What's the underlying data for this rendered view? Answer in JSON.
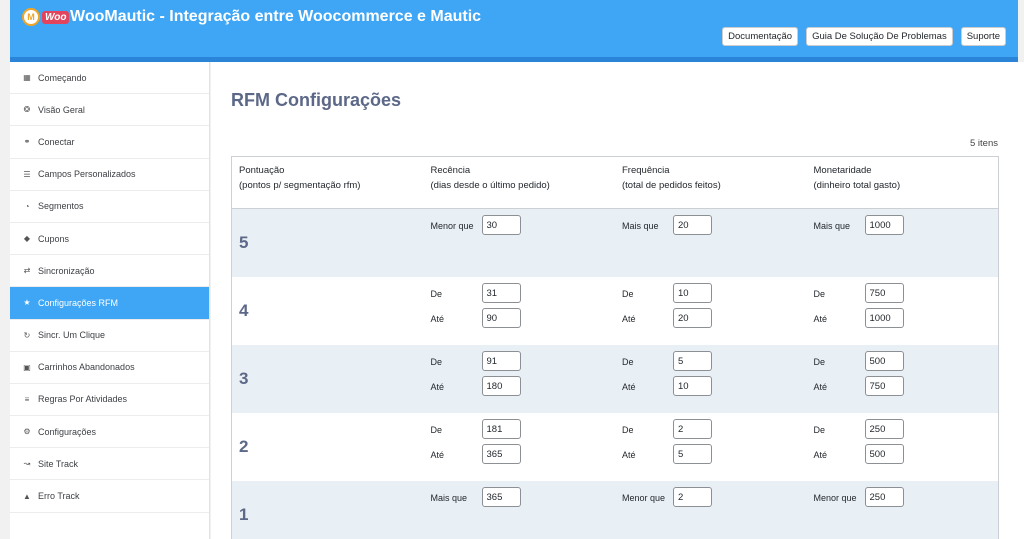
{
  "header": {
    "logo_mark": "M",
    "logo_woo": "Woo",
    "title": "WooMautic - Integração entre Woocommerce e Mautic",
    "buttons": [
      "Documentação",
      "Guia De Solução De Problemas",
      "Suporte"
    ]
  },
  "sidebar": {
    "items": [
      {
        "label": "Começando",
        "icon": "grid-icon"
      },
      {
        "label": "Visão Geral",
        "icon": "cog-circle-icon"
      },
      {
        "label": "Conectar",
        "icon": "link-icon"
      },
      {
        "label": "Campos Personalizados",
        "icon": "list-icon"
      },
      {
        "label": "Segmentos",
        "icon": "pie-chart-icon"
      },
      {
        "label": "Cupons",
        "icon": "tags-icon"
      },
      {
        "label": "Sincronização",
        "icon": "exchange-icon"
      },
      {
        "label": "Configurações RFM",
        "icon": "star-icon",
        "active": true
      },
      {
        "label": "Sincr. Um Clique",
        "icon": "refresh-icon"
      },
      {
        "label": "Carrinhos Abandonados",
        "icon": "cart-icon"
      },
      {
        "label": "Regras Por Atividades",
        "icon": "list-ol-icon"
      },
      {
        "label": "Configurações",
        "icon": "cogs-icon"
      },
      {
        "label": "Site Track",
        "icon": "line-chart-icon"
      },
      {
        "label": "Erro Track",
        "icon": "warning-icon"
      }
    ]
  },
  "main": {
    "title": "RFM Configurações",
    "items_count": "5 itens",
    "columns": [
      {
        "line1": "Pontuação",
        "line2": "(pontos p/ segmentação rfm)"
      },
      {
        "line1": "Recência",
        "line2": "(dias desde o último pedido)"
      },
      {
        "line1": "Frequência",
        "line2": "(total de pedidos feitos)"
      },
      {
        "line1": "Monetaridade",
        "line2": "(dinheiro total gasto)"
      }
    ],
    "rows": [
      {
        "score": "5",
        "cells": [
          {
            "label1": "Menor que",
            "value1": "30"
          },
          {
            "label1": "Mais que",
            "value1": "20"
          },
          {
            "label1": "Mais que",
            "value1": "1000"
          }
        ]
      },
      {
        "score": "4",
        "cells": [
          {
            "label1": "De",
            "value1": "31",
            "label2": "Até",
            "value2": "90"
          },
          {
            "label1": "De",
            "value1": "10",
            "label2": "Até",
            "value2": "20"
          },
          {
            "label1": "De",
            "value1": "750",
            "label2": "Até",
            "value2": "1000"
          }
        ]
      },
      {
        "score": "3",
        "cells": [
          {
            "label1": "De",
            "value1": "91",
            "label2": "Até",
            "value2": "180"
          },
          {
            "label1": "De",
            "value1": "5",
            "label2": "Até",
            "value2": "10"
          },
          {
            "label1": "De",
            "value1": "500",
            "label2": "Até",
            "value2": "750"
          }
        ]
      },
      {
        "score": "2",
        "cells": [
          {
            "label1": "De",
            "value1": "181",
            "label2": "Até",
            "value2": "365"
          },
          {
            "label1": "De",
            "value1": "2",
            "label2": "Até",
            "value2": "5"
          },
          {
            "label1": "De",
            "value1": "250",
            "label2": "Até",
            "value2": "500"
          }
        ]
      },
      {
        "score": "1",
        "cells": [
          {
            "label1": "Mais que",
            "value1": "365"
          },
          {
            "label1": "Menor que",
            "value1": "2"
          },
          {
            "label1": "Menor que",
            "value1": "250"
          }
        ]
      }
    ]
  }
}
